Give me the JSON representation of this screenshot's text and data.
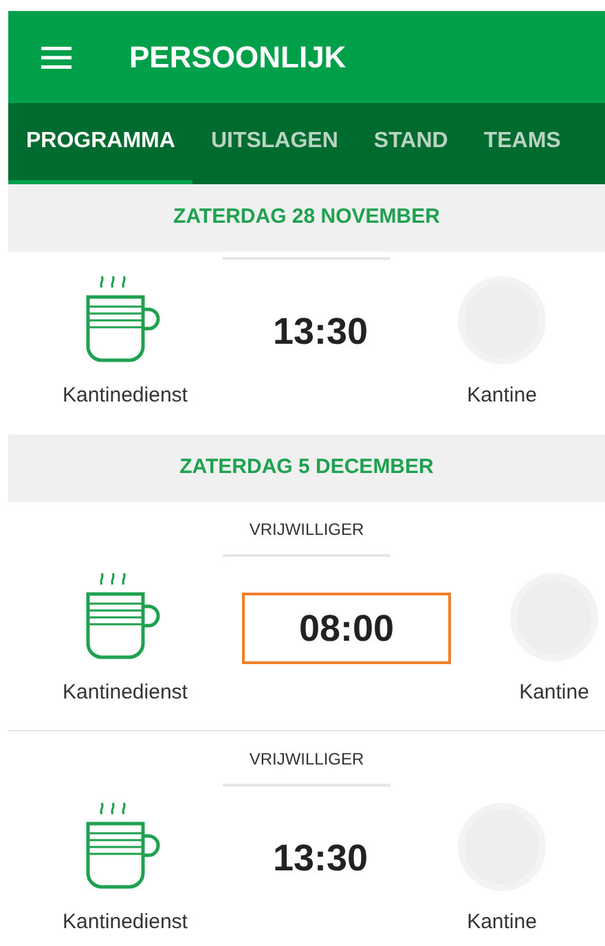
{
  "header": {
    "title": "PERSOONLIJK"
  },
  "tabs": [
    {
      "label": "PROGRAMMA",
      "selected": true
    },
    {
      "label": "UITSLAGEN",
      "selected": false
    },
    {
      "label": "STAND",
      "selected": false
    },
    {
      "label": "TEAMS",
      "selected": false
    }
  ],
  "days": [
    {
      "date": "ZATERDAG 28 NOVEMBER",
      "events": [
        {
          "time": "13:30",
          "highlighted": false,
          "duty": "Kantinedienst",
          "location": "Kantine"
        }
      ]
    },
    {
      "date": "ZATERDAG 5 DECEMBER",
      "events": [
        {
          "role": "VRIJWILLIGER",
          "time": "08:00",
          "highlighted": true,
          "duty": "Kantinedienst",
          "location": "Kantine"
        },
        {
          "role": "VRIJWILLIGER",
          "time": "13:30",
          "highlighted": false,
          "duty": "Kantinedienst",
          "location": "Kantine"
        }
      ]
    }
  ]
}
